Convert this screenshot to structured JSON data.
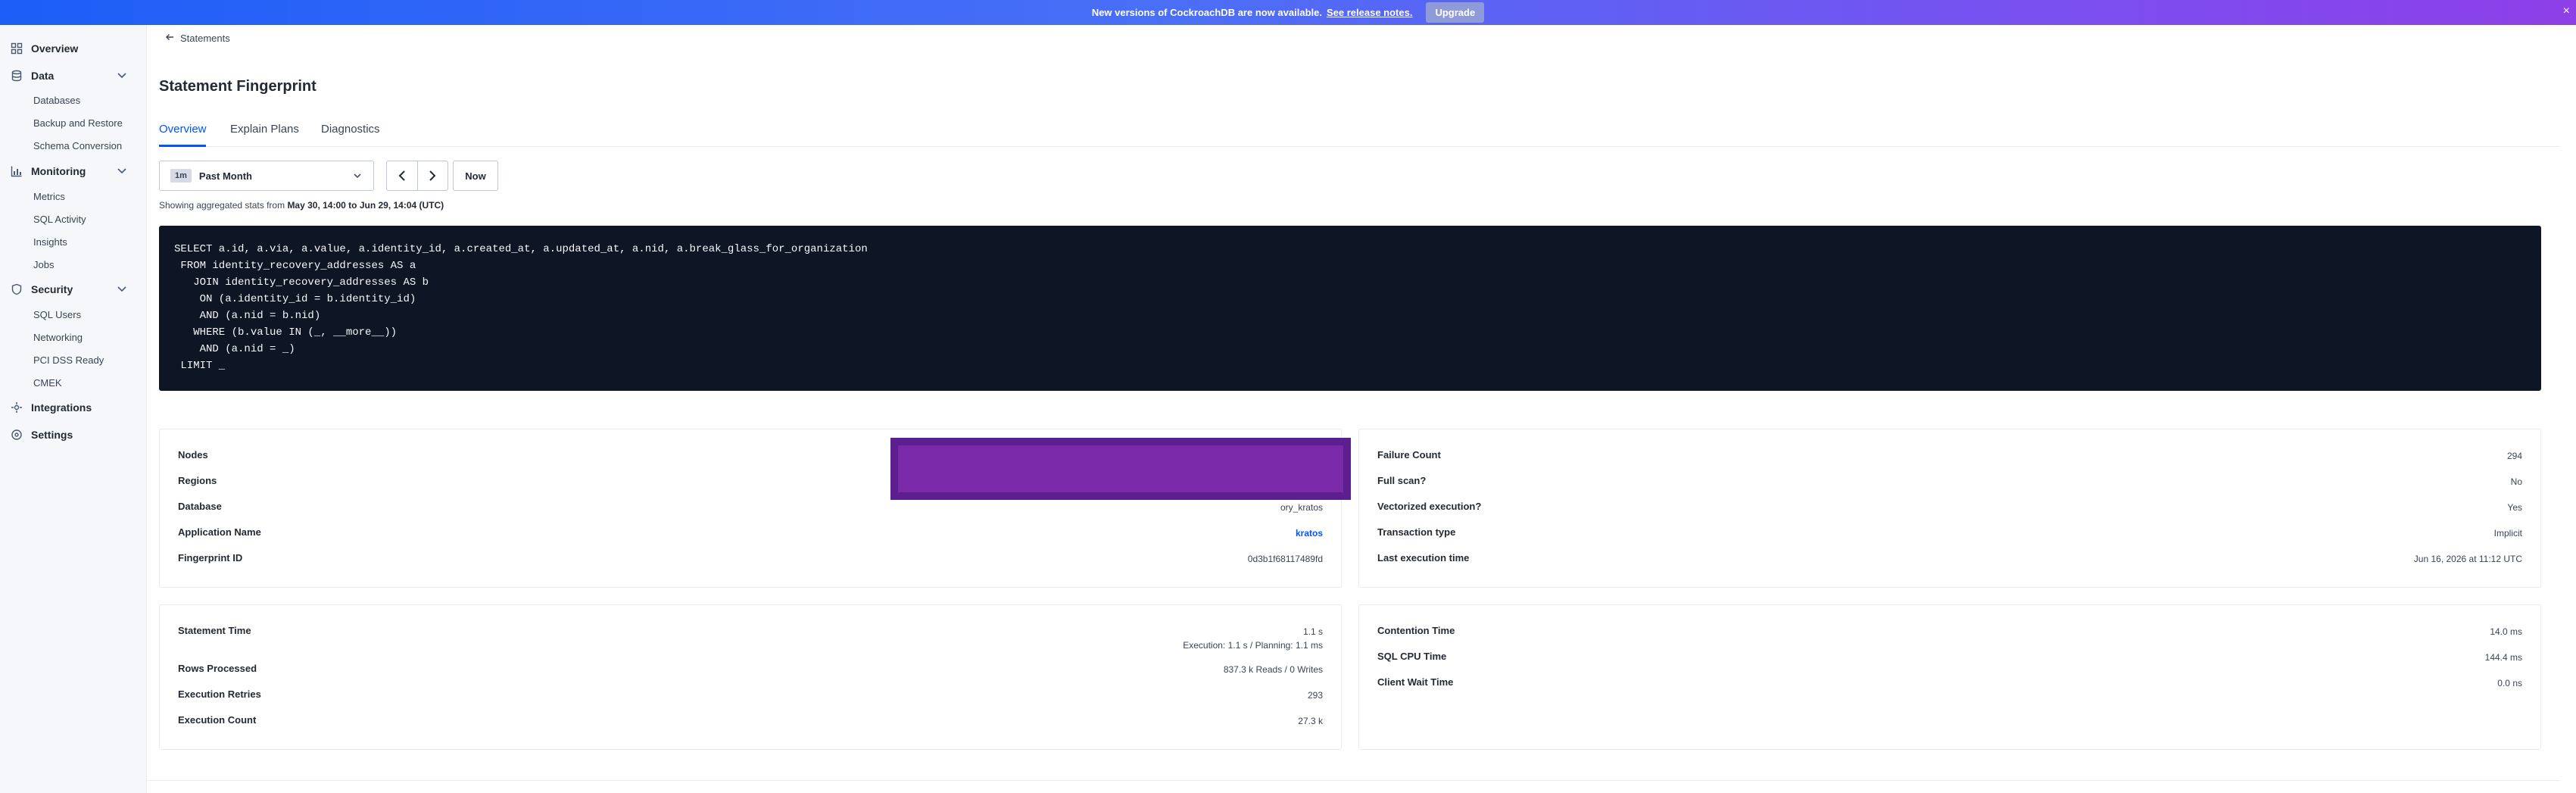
{
  "banner": {
    "message": "New versions of CockroachDB are now available.",
    "link": "See release notes.",
    "button": "Upgrade",
    "close": "×"
  },
  "sidebar": {
    "items": [
      {
        "label": "Overview",
        "icon": "overview-icon"
      },
      {
        "label": "Data",
        "icon": "database-icon",
        "children": [
          "Databases",
          "Backup and Restore",
          "Schema Conversion"
        ]
      },
      {
        "label": "Monitoring",
        "icon": "chart-icon",
        "children": [
          "Metrics",
          "SQL Activity",
          "Insights",
          "Jobs"
        ]
      },
      {
        "label": "Security",
        "icon": "shield-icon",
        "children": [
          "SQL Users",
          "Networking",
          "PCI DSS Ready",
          "CMEK"
        ]
      },
      {
        "label": "Integrations",
        "icon": "integrations-icon"
      },
      {
        "label": "Settings",
        "icon": "gear-icon"
      }
    ]
  },
  "breadcrumb": "Statements",
  "page_title": "Statement Fingerprint",
  "tabs": [
    "Overview",
    "Explain Plans",
    "Diagnostics"
  ],
  "time": {
    "badge": "1m",
    "label": "Past Month",
    "now": "Now",
    "range_prefix": "Showing aggregated stats from ",
    "range_value": "May 30, 14:00 to Jun 29, 14:04 (UTC)"
  },
  "sql": [
    "SELECT a.id, a.via, a.value, a.identity_id, a.created_at, a.updated_at, a.nid, a.break_glass_for_organization",
    " FROM identity_recovery_addresses AS a",
    "   JOIN identity_recovery_addresses AS b",
    "    ON (a.identity_id = b.identity_id)",
    "    AND (a.nid = b.nid)",
    "   WHERE (b.value IN (_, __more__))",
    "    AND (a.nid = _)",
    " LIMIT _"
  ],
  "details_left": [
    {
      "label": "Nodes",
      "value": ""
    },
    {
      "label": "Regions",
      "value": ""
    },
    {
      "label": "Database",
      "value": "ory_kratos"
    },
    {
      "label": "Application Name",
      "value": "kratos"
    },
    {
      "label": "Fingerprint ID",
      "value": "0d3b1f68117489fd"
    }
  ],
  "details_right": [
    {
      "label": "Failure Count",
      "value": "294"
    },
    {
      "label": "Full scan?",
      "value": "No"
    },
    {
      "label": "Vectorized execution?",
      "value": "Yes"
    },
    {
      "label": "Transaction type",
      "value": "Implicit"
    },
    {
      "label": "Last execution time",
      "value": "Jun 16, 2026 at 11:12 UTC"
    }
  ],
  "stats_left": {
    "statement_time": {
      "label": "Statement Time",
      "value": "1.1 s",
      "sub": "Execution: 1.1 s / Planning: 1.1 ms"
    },
    "rows_processed": {
      "label": "Rows Processed",
      "value": "837.3 k Reads / 0 Writes"
    },
    "execution_retries": {
      "label": "Execution Retries",
      "value": "293"
    },
    "execution_count": {
      "label": "Execution Count",
      "value": "27.3 k"
    }
  },
  "stats_right": {
    "contention_time": {
      "label": "Contention Time",
      "value": "14.0 ms"
    },
    "sql_cpu_time": {
      "label": "SQL CPU Time",
      "value": "144.4 ms"
    },
    "client_wait_time": {
      "label": "Client Wait Time",
      "value": "0.0 ns"
    }
  }
}
